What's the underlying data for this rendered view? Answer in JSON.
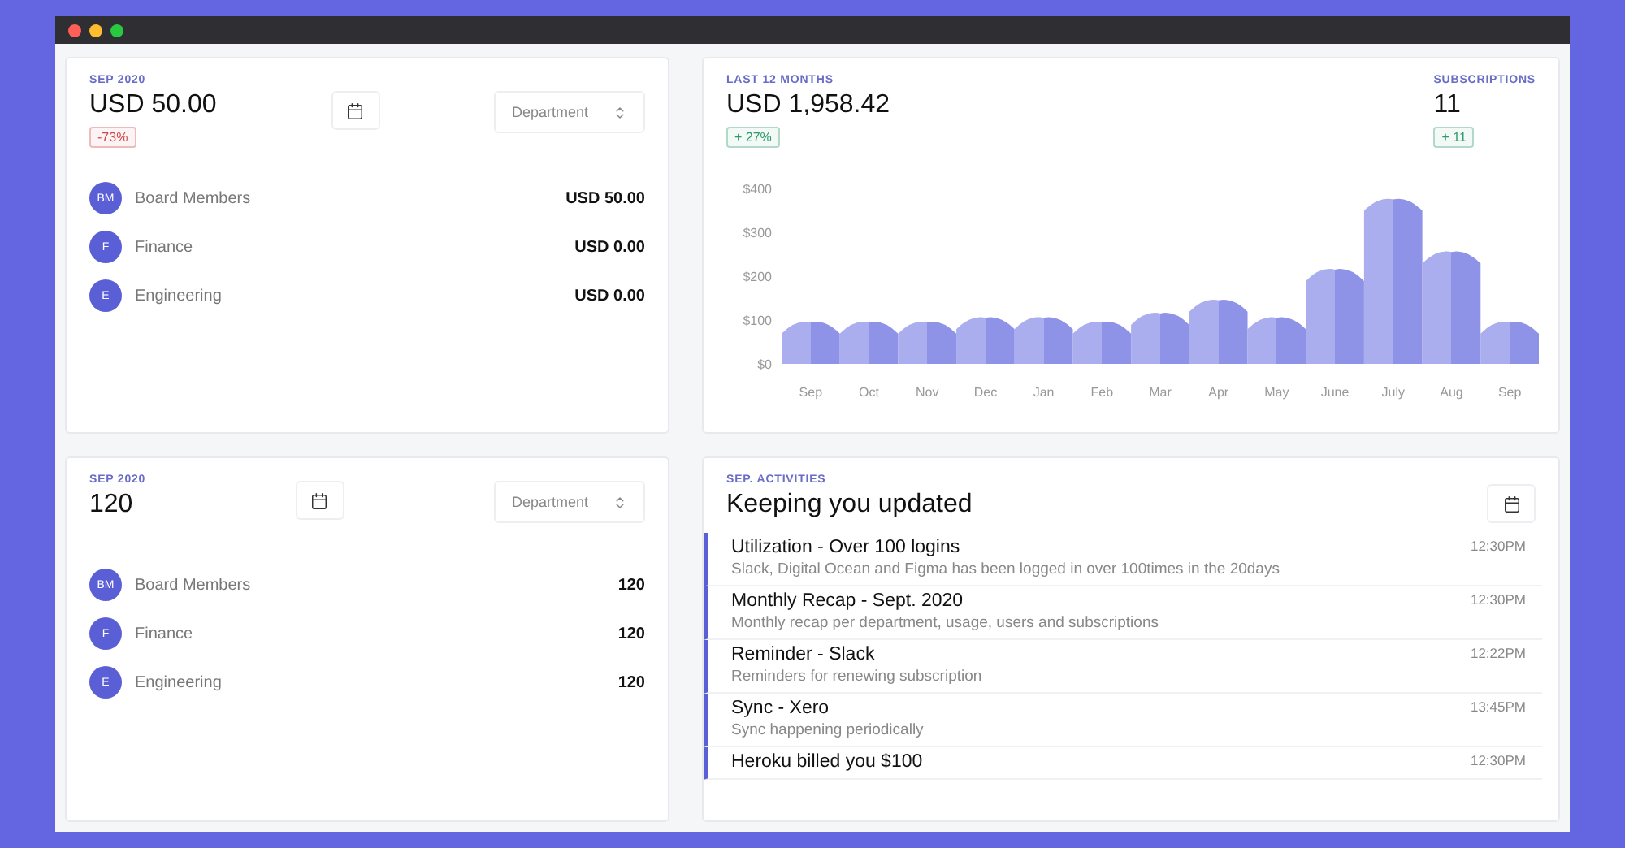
{
  "spend_card": {
    "period": "SEP 2020",
    "total": "USD 50.00",
    "change": {
      "text": "-73%",
      "color": "#d04848"
    },
    "filter": {
      "placeholder": "Department"
    },
    "departments": [
      {
        "initials": "BM",
        "name": "Board Members",
        "value": "USD 50.00"
      },
      {
        "initials": "F",
        "name": "Finance",
        "value": "USD 0.00"
      },
      {
        "initials": "E",
        "name": "Engineering",
        "value": "USD 0.00"
      }
    ]
  },
  "trend_card": {
    "period": "LAST 12 MONTHS",
    "total": "USD 1,958.42",
    "change": {
      "text": "+ 27%",
      "color": "#2f9a6a"
    },
    "subscriptions": {
      "label": "SUBSCRIPTIONS",
      "value": "11",
      "change": {
        "text": "+ 11",
        "color": "#2f9a6a"
      }
    },
    "chart_data": {
      "type": "bar",
      "categories": [
        "Sep",
        "Oct",
        "Nov",
        "Dec",
        "Jan",
        "Feb",
        "Mar",
        "Apr",
        "May",
        "June",
        "July",
        "Aug",
        "Sep"
      ],
      "series": [
        {
          "color": "#8f93e8",
          "values": [
            95,
            95,
            95,
            105,
            105,
            95,
            115,
            145,
            105,
            215,
            375,
            255,
            95
          ]
        }
      ],
      "ylim": [
        0,
        400
      ],
      "yticks": [
        {
          "value": 0,
          "label": "$0"
        },
        {
          "value": 100,
          "label": "$100"
        },
        {
          "value": 200,
          "label": "$200"
        },
        {
          "value": 300,
          "label": "$300"
        },
        {
          "value": 400,
          "label": "$400"
        }
      ]
    }
  },
  "usage_card": {
    "period": "SEP 2020",
    "total": "120",
    "filter": {
      "placeholder": "Department"
    },
    "departments": [
      {
        "initials": "BM",
        "name": "Board Members",
        "value": "120"
      },
      {
        "initials": "F",
        "name": "Finance",
        "value": "120"
      },
      {
        "initials": "E",
        "name": "Engineering",
        "value": "120"
      }
    ]
  },
  "activity_card": {
    "period": "SEP. ACTIVITIES",
    "title": "Keeping you updated",
    "items": [
      {
        "title": "Utilization - Over 100 logins",
        "description": "Slack, Digital Ocean and Figma has been logged in over 100times in the 20days",
        "time": "12:30PM"
      },
      {
        "title": "Monthly Recap - Sept. 2020",
        "description": "Monthly recap per department, usage, users and subscriptions",
        "time": "12:30PM"
      },
      {
        "title": "Reminder - Slack",
        "description": "Reminders for renewing subscription",
        "time": "12:22PM"
      },
      {
        "title": "Sync - Xero",
        "description": "Sync happening periodically",
        "time": "13:45PM"
      },
      {
        "title": "Heroku billed you $100",
        "time": "12:30PM"
      }
    ]
  }
}
